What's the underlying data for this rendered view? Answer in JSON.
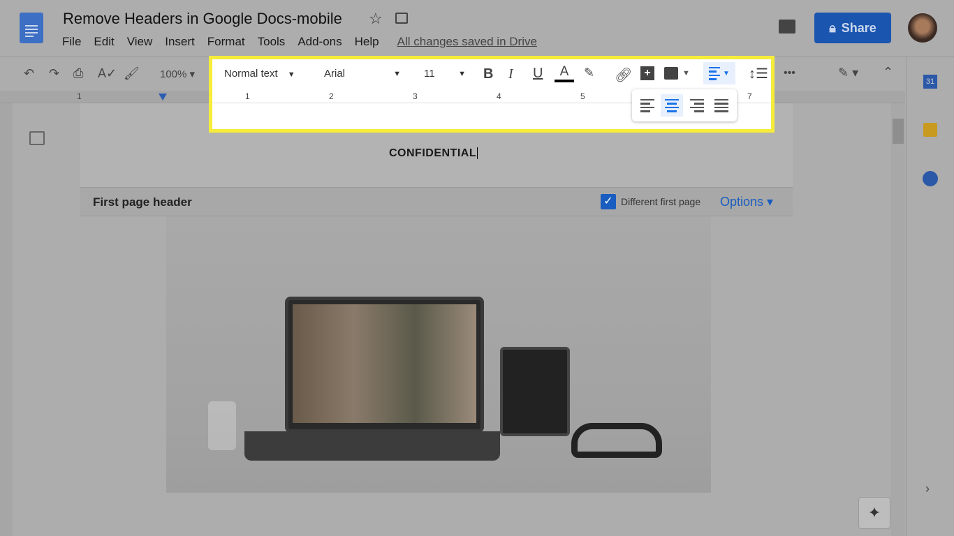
{
  "doc": {
    "title": "Remove Headers in Google Docs-mobile",
    "saved_status": "All changes saved in Drive"
  },
  "menu": [
    "File",
    "Edit",
    "View",
    "Insert",
    "Format",
    "Tools",
    "Add-ons",
    "Help"
  ],
  "share": {
    "label": "Share"
  },
  "toolbar": {
    "zoom": "100%",
    "style": "Normal text",
    "font": "Arial",
    "size": "11",
    "selected_alignment": "center"
  },
  "ruler": [
    "1",
    "1",
    "2",
    "3",
    "4",
    "5",
    "7"
  ],
  "document": {
    "header_text": "CONFIDENTIAL",
    "section_label": "First page header",
    "different_first_page_label": "Different first page",
    "different_first_page_checked": true,
    "options_label": "Options"
  },
  "colors": {
    "accent": "#1a73e8",
    "highlight": "#f6ec3a",
    "share": "#1a55b0"
  }
}
